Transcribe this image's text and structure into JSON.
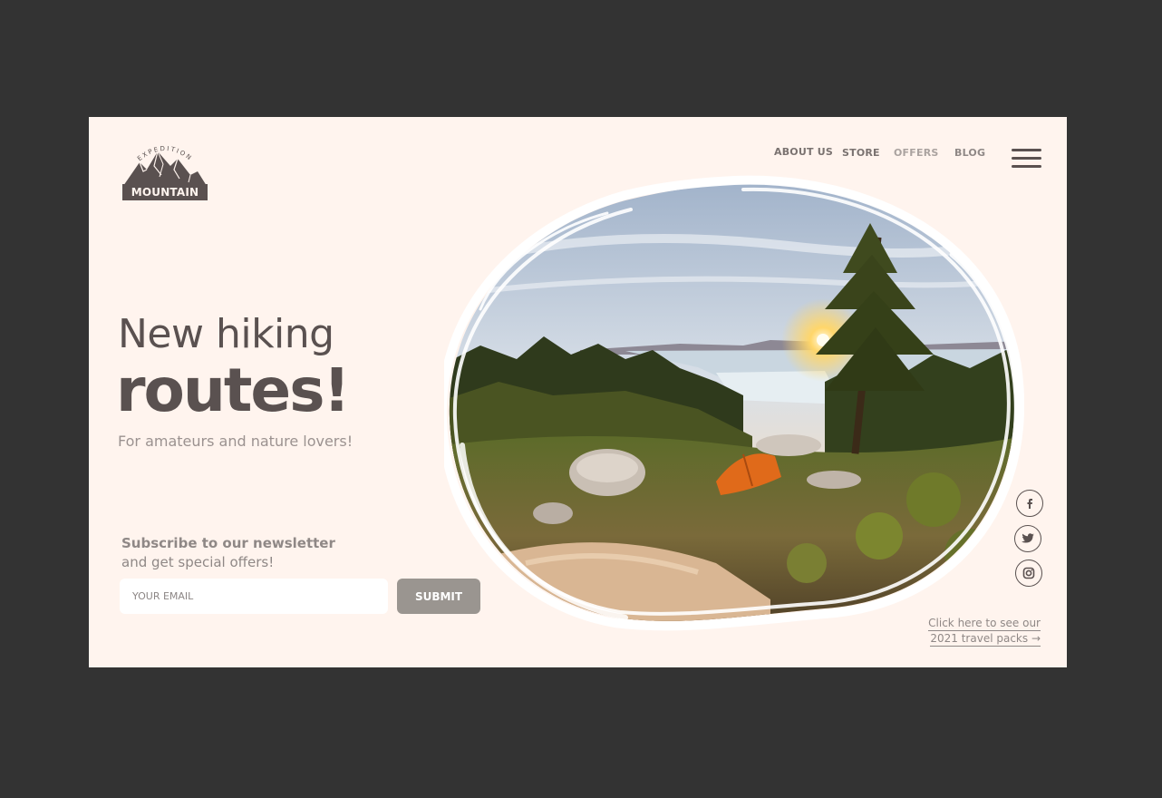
{
  "brand": {
    "logo_top_text": "EXPEDITION",
    "logo_wordmark": "MOUNTAIN"
  },
  "nav": {
    "items": [
      "ABOUT US",
      "STORE",
      "OFFERS",
      "BLOG"
    ],
    "menu_icon": "hamburger-menu-icon"
  },
  "hero": {
    "line1": "New hiking",
    "line2": "routes!",
    "subtitle": "For amateurs and nature lovers!"
  },
  "newsletter": {
    "title": "Subscribe to our newsletter",
    "subtitle": "and get special offers!",
    "email_placeholder": "YOUR EMAIL",
    "submit_label": "SUBMIT"
  },
  "social": {
    "icons": [
      "facebook-icon",
      "twitter-icon",
      "instagram-icon"
    ]
  },
  "cta": {
    "line1": "Click here to see our",
    "line2": "2021 travel packs →"
  },
  "colors": {
    "background": "#fff4ee",
    "outer": "#333333",
    "text_dark": "#5a5150",
    "text_muted": "#9b9290",
    "button": "#9a9590"
  }
}
